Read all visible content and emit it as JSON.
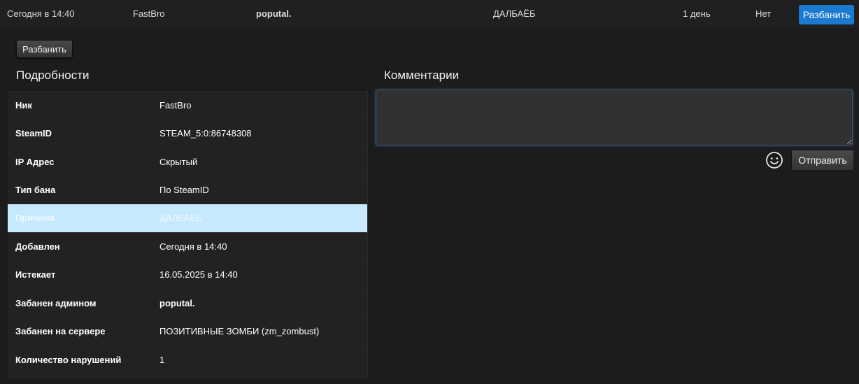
{
  "topbar": {
    "date": "Сегодня в 14:40",
    "nick": "FastBro",
    "admin": "poputal.",
    "reason": "ДАЛБАЁБ",
    "duration": "1 день",
    "status": "Нет",
    "unban_label": "Разбанить"
  },
  "actions": {
    "unban_label": "Разбанить"
  },
  "details": {
    "title": "Подробности",
    "rows": [
      {
        "key": "Ник",
        "value": "FastBro"
      },
      {
        "key": "SteamID",
        "value": "STEAM_5:0:86748308"
      },
      {
        "key": "IP Адрес",
        "value": "Скрытый"
      },
      {
        "key": "Тип бана",
        "value": "По SteamID"
      },
      {
        "key": "Причина",
        "value": "ДАЛБАЁБ"
      },
      {
        "key": "Добавлен",
        "value": "Сегодня в 14:40"
      },
      {
        "key": "Истекает",
        "value": "16.05.2025 в 14:40"
      },
      {
        "key": "Забанен админом",
        "value": "poputal."
      },
      {
        "key": "Забанен на сервере",
        "value": "ПОЗИТИВНЫЕ ЗОМБИ (zm_zombust)"
      },
      {
        "key": "Количество нарушений",
        "value": "1"
      }
    ]
  },
  "comments": {
    "title": "Комментарии",
    "input_value": "",
    "send_label": "Отправить",
    "emoji_icon": "smiley-icon"
  },
  "colors": {
    "accent": "#1b7ad0",
    "highlight_row": "#c6e9fd",
    "background": "#1c1c1c"
  }
}
